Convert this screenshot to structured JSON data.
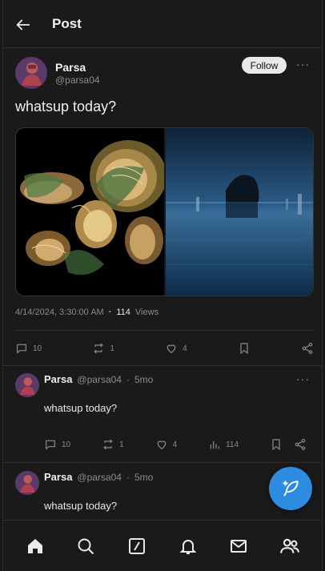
{
  "header": {
    "title": "Post"
  },
  "post": {
    "author_name": "Parsa",
    "author_handle": "@parsa04",
    "follow_label": "Follow",
    "more_label": "···",
    "text": "whatsup today?",
    "timestamp": "4/14/2024, 3:30:00 AM",
    "dot": "·",
    "views_count": "114",
    "views_label": "Views",
    "stats": {
      "replies": "10",
      "reposts": "1",
      "likes": "4"
    }
  },
  "replies": [
    {
      "name": "Parsa",
      "handle": "@parsa04",
      "dot": "·",
      "age": "5mo",
      "text": "whatsup today?",
      "stats": {
        "replies": "10",
        "reposts": "1",
        "likes": "4",
        "views": "114"
      }
    },
    {
      "name": "Parsa",
      "handle": "@parsa04",
      "dot": "·",
      "age": "5mo",
      "text": "whatsup today?"
    }
  ],
  "icons": {
    "back": "arrow-left-icon",
    "reply": "comment-icon",
    "repost": "repost-icon",
    "like": "heart-icon",
    "bookmark": "bookmark-icon",
    "share": "share-icon",
    "views": "bar-chart-icon",
    "compose": "feather-plus-icon",
    "nav": [
      "home-icon",
      "search-icon",
      "grok-icon",
      "bell-icon",
      "mail-icon",
      "people-icon"
    ]
  },
  "colors": {
    "accent": "#2d8ce0",
    "background": "#1a1a1a",
    "muted": "#8b8b8b"
  }
}
